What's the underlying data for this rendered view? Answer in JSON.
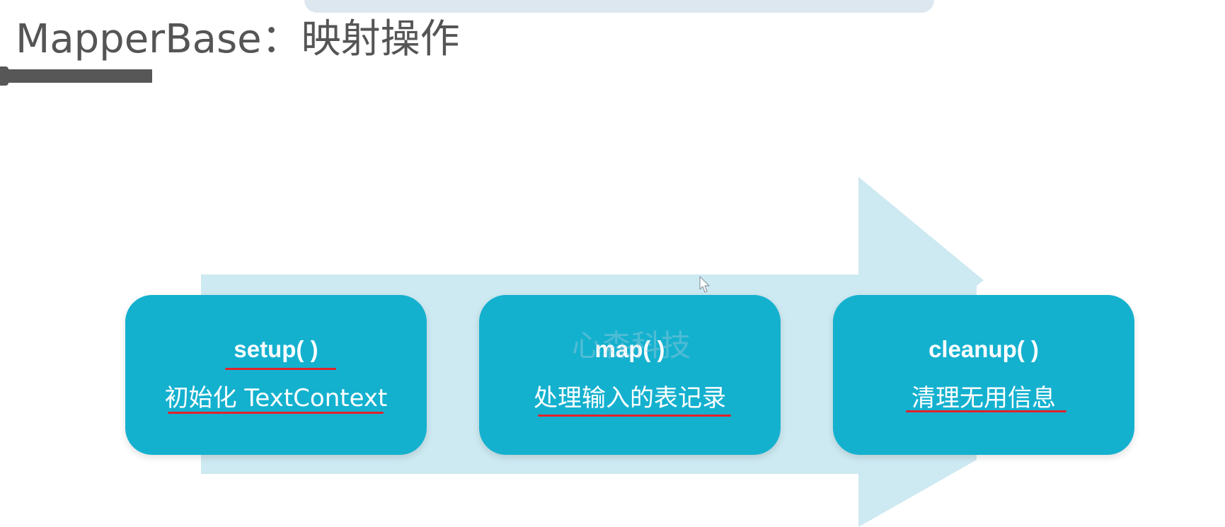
{
  "title": "MapperBase：映射操作",
  "steps": [
    {
      "func": "setup( )",
      "desc": "初始化 TextContext"
    },
    {
      "func": "map( )",
      "desc": "处理输入的表记录"
    },
    {
      "func": "cleanup( )",
      "desc": "清理无用信息"
    }
  ],
  "watermark": "心森科技",
  "colors": {
    "box": "#14b1cf",
    "arrow": "#cde9f1",
    "underline": "#e3222a",
    "title": "#555555"
  }
}
